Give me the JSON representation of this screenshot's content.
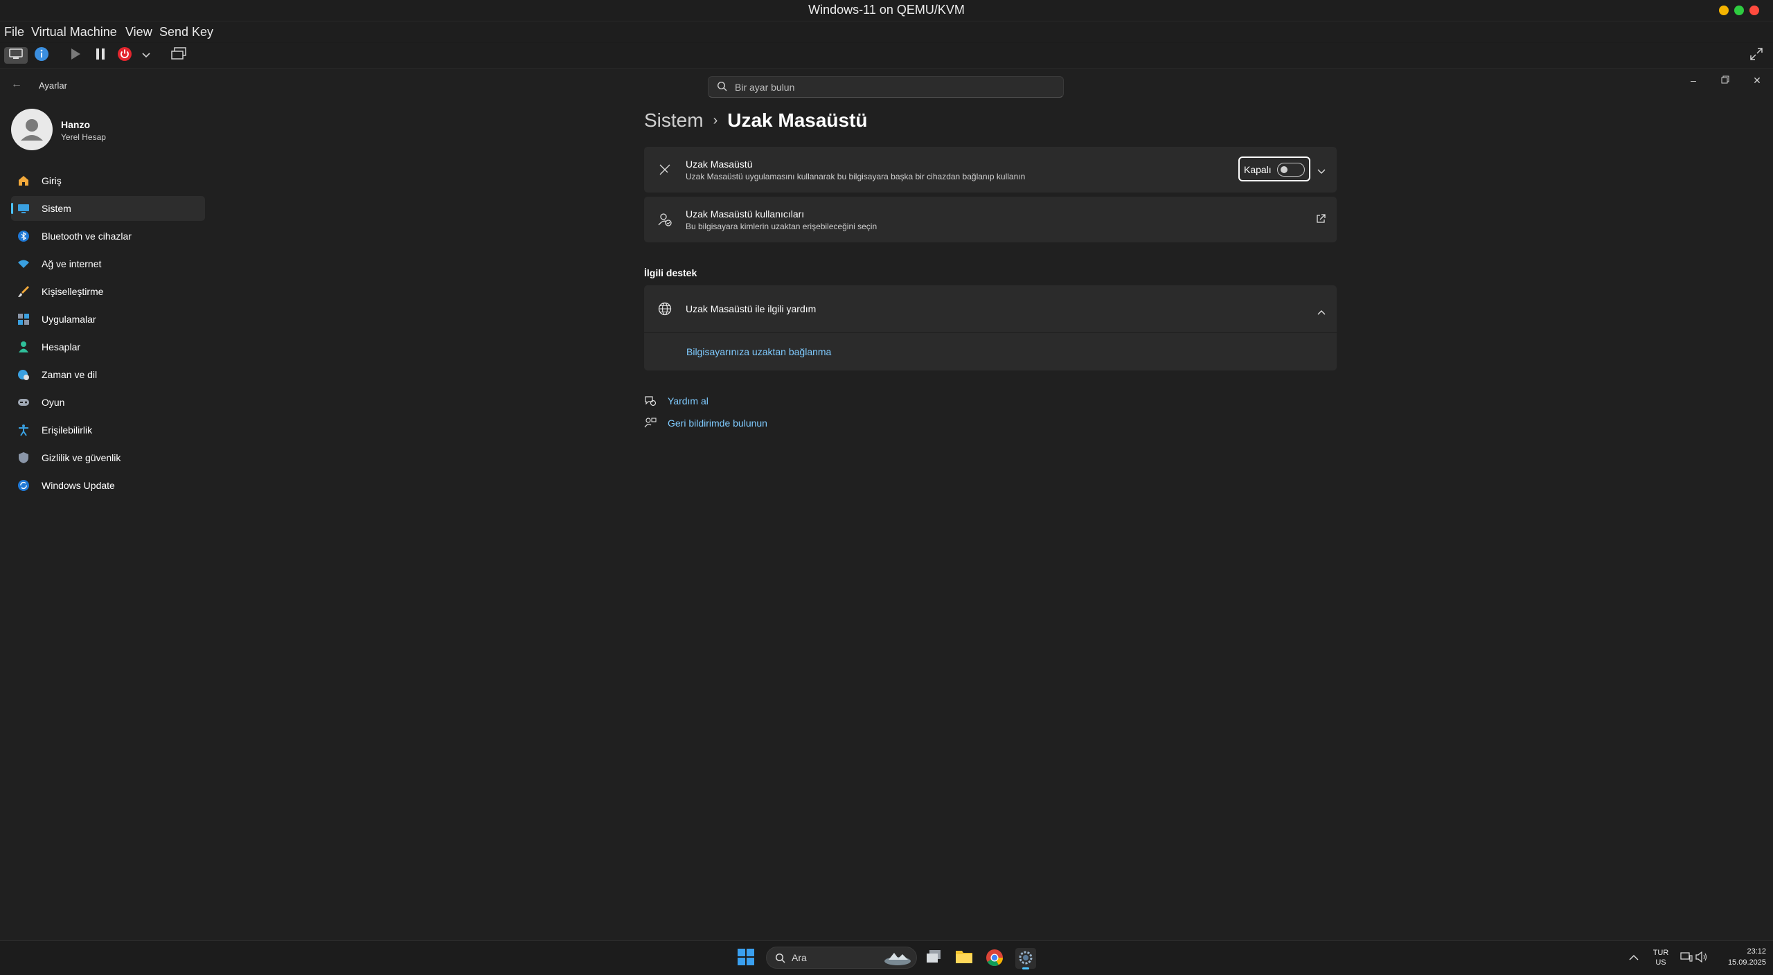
{
  "host": {
    "title": "Windows-11 on QEMU/KVM",
    "menu": [
      "File",
      "Virtual Machine",
      "View",
      "Send Key"
    ],
    "traffic_colors": [
      "#f5b400",
      "#2ecc40",
      "#ff4b3e"
    ]
  },
  "guest": {
    "app_title": "Ayarlar",
    "search_placeholder": "Bir ayar bulun",
    "user": {
      "name": "Hanzo",
      "account_type": "Yerel Hesap"
    },
    "nav": [
      {
        "label": "Giriş",
        "icon": "home-icon"
      },
      {
        "label": "Sistem",
        "icon": "system-icon",
        "selected": true
      },
      {
        "label": "Bluetooth ve cihazlar",
        "icon": "bluetooth-icon"
      },
      {
        "label": "Ağ ve internet",
        "icon": "wifi-icon"
      },
      {
        "label": "Kişiselleştirme",
        "icon": "brush-icon"
      },
      {
        "label": "Uygulamalar",
        "icon": "apps-icon"
      },
      {
        "label": "Hesaplar",
        "icon": "person-icon"
      },
      {
        "label": "Zaman ve dil",
        "icon": "globe-clock-icon"
      },
      {
        "label": "Oyun",
        "icon": "gamepad-icon"
      },
      {
        "label": "Erişilebilirlik",
        "icon": "accessibility-icon"
      },
      {
        "label": "Gizlilik ve güvenlik",
        "icon": "shield-icon"
      },
      {
        "label": "Windows Update",
        "icon": "update-icon"
      }
    ],
    "breadcrumb": {
      "parent": "Sistem",
      "current": "Uzak Masaüstü"
    },
    "remote_desktop": {
      "title": "Uzak Masaüstü",
      "description": "Uzak Masaüstü uygulamasını kullanarak bu bilgisayara başka bir cihazdan bağlanıp kullanın",
      "toggle_label": "Kapalı",
      "toggle_on": false
    },
    "remote_users": {
      "title": "Uzak Masaüstü kullanıcıları",
      "description": "Bu bilgisayara kimlerin uzaktan erişebileceğini seçin"
    },
    "related": {
      "header": "İlgili destek",
      "help_title": "Uzak Masaüstü ile ilgili yardım",
      "help_link": "Bilgisayarınıza uzaktan bağlanma"
    },
    "footer_links": {
      "get_help": "Yardım al",
      "feedback": "Geri bildirimde bulunun"
    },
    "accent_color": "#4cc2ff"
  },
  "taskbar": {
    "search_label": "Ara",
    "language": "TUR",
    "layout": "US",
    "time": "23:12",
    "date": "15.09.2025"
  }
}
